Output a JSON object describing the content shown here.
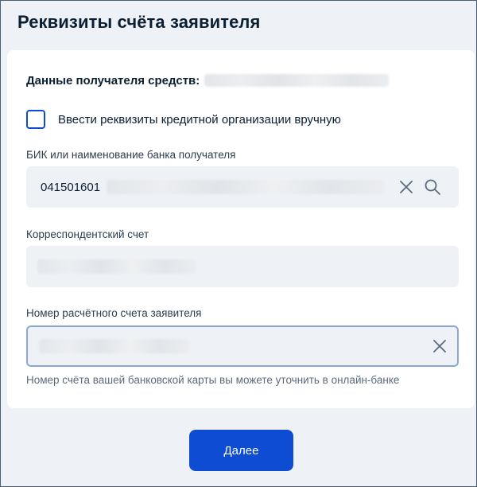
{
  "page": {
    "title": "Реквизиты счёта заявителя"
  },
  "recipient": {
    "label": "Данные получателя средств:"
  },
  "manual_entry": {
    "label": "Ввести реквизиты кредитной организации вручную",
    "checked": false
  },
  "bank_field": {
    "label": "БИК или наименование банка получателя",
    "value": "041501601"
  },
  "correspondent_field": {
    "label": "Корреспондентский счет"
  },
  "account_field": {
    "label": "Номер расчётного счета заявителя",
    "hint": "Номер счёта вашей банковской карты вы можете уточнить в онлайн-банке"
  },
  "actions": {
    "next_label": "Далее"
  },
  "colors": {
    "primary": "#0d4cd3",
    "field_bg": "#eef2f7",
    "text": "#0b1f33"
  },
  "icons": {
    "clear": "close-icon",
    "search": "search-icon"
  }
}
